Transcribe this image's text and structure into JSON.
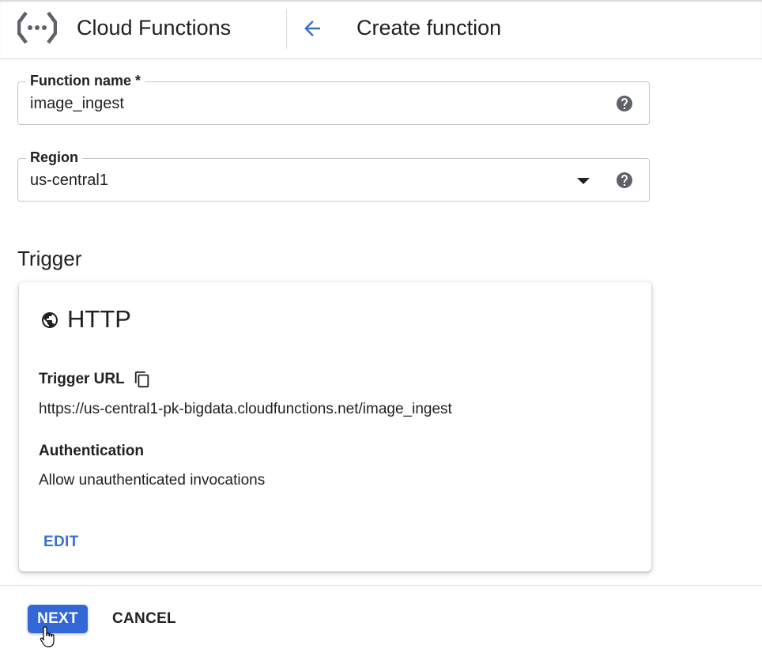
{
  "header": {
    "product_title": "Cloud Functions",
    "page_title": "Create function",
    "logo_icon": "cloud-functions-logo",
    "back_icon": "arrow-back-icon"
  },
  "form": {
    "function_name": {
      "label": "Function name *",
      "value": "image_ingest",
      "help_icon": "help-icon"
    },
    "region": {
      "label": "Region",
      "value": "us-central1",
      "dropdown_icon": "arrow-drop-down-icon",
      "help_icon": "help-icon"
    }
  },
  "trigger": {
    "heading": "Trigger",
    "type": "HTTP",
    "type_icon": "globe-icon",
    "url_label": "Trigger URL",
    "url_copy_icon": "copy-icon",
    "url": "https://us-central1-pk-bigdata.cloudfunctions.net/image_ingest",
    "auth_label": "Authentication",
    "auth_value": "Allow unauthenticated invocations",
    "edit_label": "EDIT"
  },
  "footer": {
    "next_label": "NEXT",
    "cancel_label": "CANCEL"
  },
  "colors": {
    "primary": "#3367d6",
    "link": "#3b6fd1",
    "text": "#202124",
    "icon": "#5f6368"
  }
}
